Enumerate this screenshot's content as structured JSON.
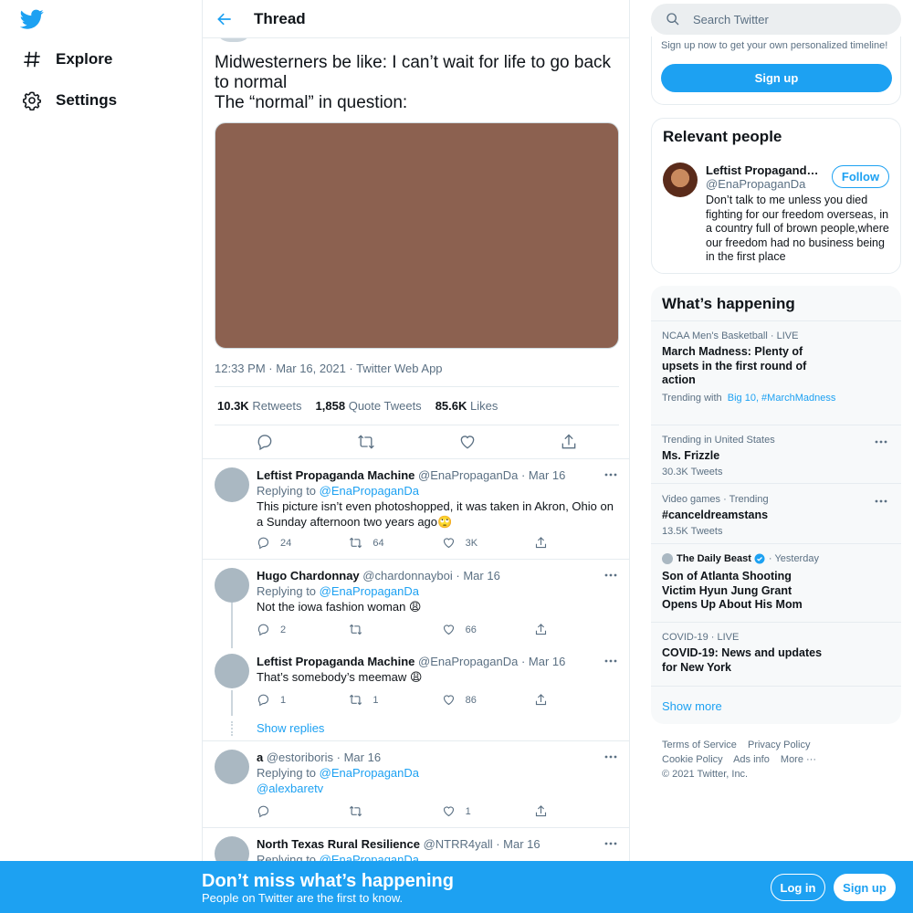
{
  "nav": {
    "items": [
      {
        "label": "Explore",
        "icon": "hashtag-icon"
      },
      {
        "label": "Settings",
        "icon": "gear-icon"
      }
    ]
  },
  "header": {
    "title": "Thread"
  },
  "tweet": {
    "text_lines": [
      "Midwesterners be like: I can’t wait for life to go back to normal",
      "The “normal” in question:"
    ],
    "meta": "12:33 PM · Mar 16, 2021 · Twitter Web App",
    "stats": [
      {
        "value": "10.3K",
        "label": "Retweets"
      },
      {
        "value": "1,858",
        "label": "Quote Tweets"
      },
      {
        "value": "85.6K",
        "label": "Likes"
      }
    ]
  },
  "replies": [
    {
      "name": "Leftist Propaganda Machine",
      "handle": "@EnaPropaganDa",
      "date": "· Mar 16",
      "replying_label": "Replying to",
      "replying_to": "@EnaPropaganDa",
      "text": "This picture isn’t even photoshopped, it was taken in Akron, Ohio on a Sunday afternoon two years ago🙄",
      "counts": {
        "reply": "24",
        "retweet": "64",
        "like": "3K"
      }
    },
    {
      "name": "Hugo Chardonnay",
      "handle": "@chardonnayboi",
      "date": "· Mar 16",
      "replying_label": "Replying to",
      "replying_to": "@EnaPropaganDa",
      "text": "Not the iowa fashion woman 😩",
      "counts": {
        "reply": "2",
        "retweet": "",
        "like": "66"
      }
    },
    {
      "name": "Leftist Propaganda Machine",
      "handle": "@EnaPropaganDa",
      "date": "· Mar 16",
      "text": "That’s somebody’s meemaw 😩",
      "counts": {
        "reply": "1",
        "retweet": "1",
        "like": "86"
      }
    },
    {
      "name": "a",
      "handle": "@estoriboris",
      "date": "· Mar 16",
      "replying_label": "Replying to",
      "replying_to": "@EnaPropaganDa",
      "text": "@alexbaretv",
      "counts": {
        "reply": "",
        "retweet": "",
        "like": "1"
      }
    },
    {
      "name": "North Texas Rural Resilience",
      "handle": "@NTRR4yall",
      "date": "· Mar 16",
      "replying_label": "Replying to",
      "replying_to": "@EnaPropaganDa"
    }
  ],
  "show_replies": "Show replies",
  "right": {
    "search_placeholder": "Search Twitter",
    "signup_note": "Sign up now to get your own personalized timeline!",
    "signup_button": "Sign up",
    "relevant_title": "Relevant people",
    "person": {
      "name": "Leftist Propaganda Machine",
      "handle": "@EnaPropaganDa",
      "follow": "Follow",
      "bio": "Don’t talk to me unless you died fighting for our freedom overseas, in a country full of brown people,where our freedom had no business being in the first place"
    },
    "happening_title": "What’s happening",
    "trends": [
      {
        "meta": "NCAA Men's Basketball · LIVE",
        "title": "March Madness: Plenty of upsets in the first round of action",
        "trending_with_label": "Trending with",
        "trending_with": "Big 10, #MarchMadness"
      },
      {
        "meta": "Trending in United States",
        "title": "Ms. Frizzle",
        "sub": "30.3K Tweets"
      },
      {
        "meta": "Video games · Trending",
        "title": "#canceldreamstans",
        "sub": "13.5K Tweets"
      },
      {
        "source": "The Daily Beast",
        "when": "· Yesterday",
        "title": "Son of Atlanta Shooting Victim Hyun Jung Grant Opens Up About His Mom"
      },
      {
        "meta": "COVID-19 · LIVE",
        "title": "COVID-19: News and updates for New York"
      }
    ],
    "show_more": "Show more",
    "footer": [
      "Terms of Service",
      "Privacy Policy",
      "Cookie Policy",
      "Ads info",
      "More ···",
      "© 2021 Twitter, Inc."
    ]
  },
  "banner": {
    "title": "Don’t miss what’s happening",
    "subtitle": "People on Twitter are the first to know.",
    "login": "Log in",
    "signup": "Sign up"
  },
  "colors": {
    "accent": "#1da1f2",
    "text": "#0f1419",
    "muted": "#5b7083",
    "media": "#8c6150"
  }
}
